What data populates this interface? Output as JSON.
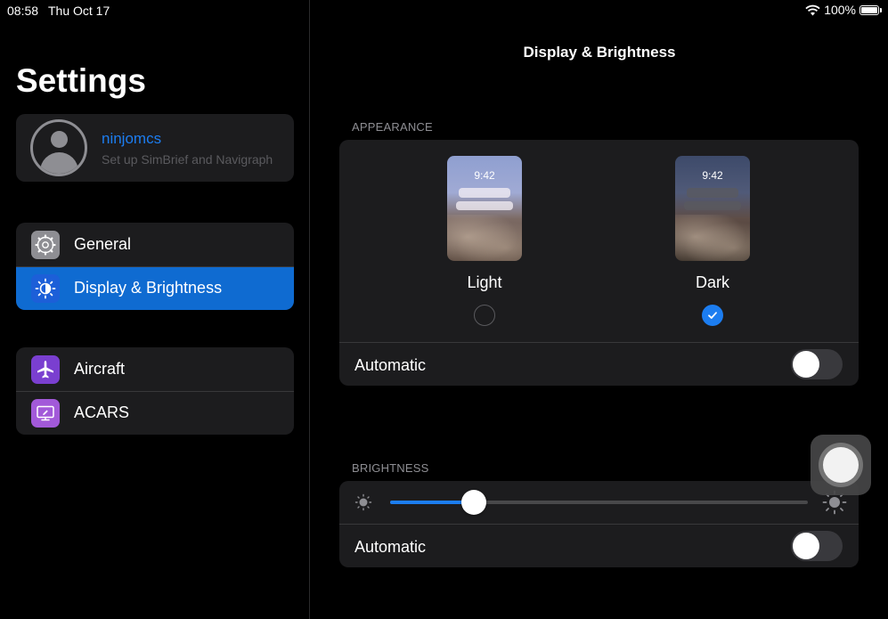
{
  "status_bar": {
    "time": "08:58",
    "date": "Thu Oct 17",
    "battery": "100%"
  },
  "sidebar": {
    "title": "Settings",
    "profile": {
      "name": "ninjomcs",
      "subtitle": "Set up SimBrief and Navigraph"
    },
    "groups": [
      {
        "items": [
          {
            "label": "General",
            "icon": "gear-icon",
            "icon_bg": "#8e8e93",
            "active": false
          },
          {
            "label": "Display & Brightness",
            "icon": "brightness-icon",
            "icon_bg": "#1c5fd8",
            "active": true
          }
        ]
      },
      {
        "items": [
          {
            "label": "Aircraft",
            "icon": "airplane-icon",
            "icon_bg": "#7a3fd0",
            "active": false
          },
          {
            "label": "ACARS",
            "icon": "monitor-icon",
            "icon_bg": "#a259d9",
            "active": false
          }
        ]
      }
    ]
  },
  "main": {
    "title": "Display & Brightness",
    "appearance": {
      "section_label": "APPEARANCE",
      "options": [
        {
          "label": "Light",
          "preview_time": "9:42",
          "selected": false
        },
        {
          "label": "Dark",
          "preview_time": "9:42",
          "selected": true
        }
      ],
      "automatic_label": "Automatic",
      "automatic_on": false
    },
    "brightness": {
      "section_label": "BRIGHTNESS",
      "level": 0.2,
      "automatic_label": "Automatic",
      "automatic_on": false
    }
  },
  "colors": {
    "accent": "#1c7df0",
    "active_row": "#0f6bd1",
    "card_bg": "#1c1c1e"
  }
}
